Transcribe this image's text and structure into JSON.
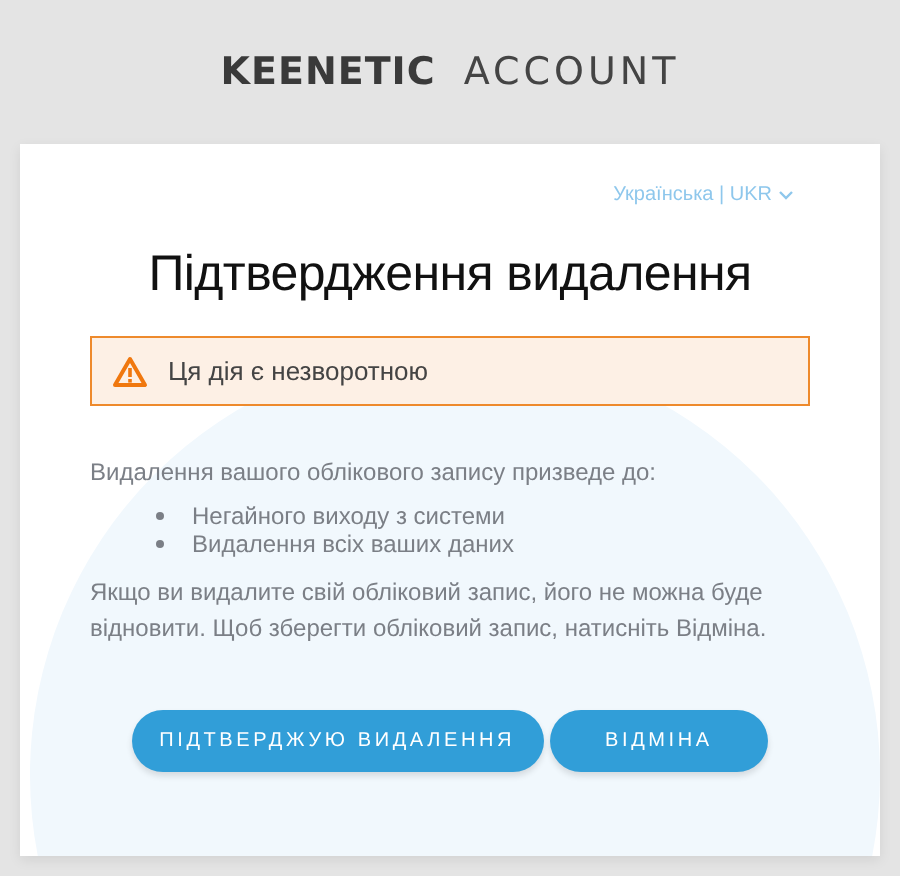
{
  "logo": {
    "brand": "KEENETIC",
    "product": "ACCOUNT"
  },
  "language": "Українська | UKR",
  "title": "Підтвердження видалення",
  "alert": {
    "kind": "warning",
    "text": "Ця дія є незворотною"
  },
  "intro": "Видалення вашого облікового запису призведе до:",
  "consequences": [
    "Негайного виходу з системи",
    "Видалення всіх ваших даних"
  ],
  "note": "Якщо ви видалите свій обліковий запис, його не можна буде відновити. Щоб зберегти обліковий запис, натисніть Відміна.",
  "buttons": [
    {
      "label": "ПІДТВЕРДЖУЮ ВИДАЛЕННЯ"
    },
    {
      "label": "ВІДМІНА"
    }
  ]
}
